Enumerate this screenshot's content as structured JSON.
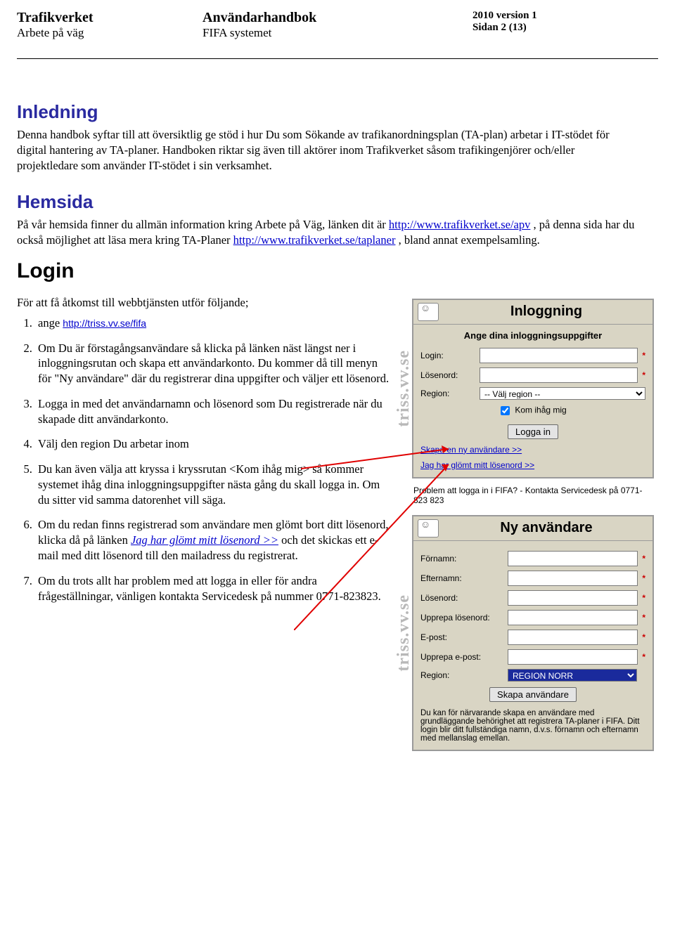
{
  "header": {
    "left_bold": "Trafikverket",
    "left_sub": "Arbete på väg",
    "center_bold": "Användarhandbok",
    "center_sub": "FIFA systemet",
    "version": "2010 version 1",
    "page": "Sidan 2 (13)"
  },
  "sections": {
    "inledning_title": "Inledning",
    "inledning_body": "Denna handbok syftar till att översiktlig ge stöd i hur Du som Sökande av trafikanordningsplan (TA-plan) arbetar i IT-stödet för digital hantering av TA-planer. Handboken riktar sig även till aktörer inom Trafikverket såsom trafikingenjörer och/eller projektledare som använder IT-stödet i sin verksamhet.",
    "hemsida_title": "Hemsida",
    "hemsida_pre": "På vår hemsida finner du allmän information kring Arbete på Väg, länken dit är ",
    "hemsida_link1": "http://www.trafikverket.se/apv",
    "hemsida_mid": " , på denna sida har du också möjlighet att läsa mera kring TA-Planer ",
    "hemsida_link2": "http://www.trafikverket.se/taplaner",
    "hemsida_post": " , bland annat exempelsamling.",
    "login_title": "Login"
  },
  "steps": {
    "intro": "För att få åtkomst till webbtjänsten utför följande;",
    "s1_pre": "ange ",
    "s1_link": "http://triss.vv.se/fifa",
    "s2": "Om Du är förstagångsanvändare så klicka på länken näst längst ner i inloggningsrutan och skapa ett användarkonto. Du kommer då till menyn för \"Ny användare\" där du registrerar dina uppgifter och väljer ett lösenord.",
    "s3": "Logga in med det användarnamn och lösenord som Du registrerade när du skapade ditt användarkonto.",
    "s4": "Välj den region Du arbetar inom",
    "s5": "Du kan även välja att kryssa i kryssrutan <Kom ihåg mig> så kommer systemet ihåg dina inloggningsuppgifter nästa gång du skall logga in. Om du sitter vid samma datorenhet vill säga.",
    "s6_pre": "Om du redan finns registrerad som användare men glömt bort ditt lösenord, klicka då på länken ",
    "s6_link": "Jag har glömt mitt lösenord >>",
    "s6_post": " och det skickas ett e-mail med ditt lösenord till den mailadress du registrerat.",
    "s7": "Om du trots allt har problem med att logga in eller för andra frågeställningar, vänligen kontakta Servicedesk på nummer 0771-823823."
  },
  "login_panel": {
    "title": "Inloggning",
    "subtitle": "Ange dina inloggningsuppgifter",
    "login_label": "Login:",
    "password_label": "Lösenord:",
    "region_label": "Region:",
    "region_placeholder": "-- Välj region --",
    "remember_label": "Kom ihåg mig",
    "button": "Logga in",
    "link_new": "Skapa en ny användare >>",
    "link_forgot": "Jag har glömt mitt lösenord >>",
    "watermark": "triss.vv.se"
  },
  "problem_text": "Problem att logga in i FIFA? - Kontakta Servicedesk på 0771-823 823",
  "newuser_panel": {
    "title": "Ny användare",
    "fornamn": "Förnamn:",
    "efternamn": "Efternamn:",
    "losenord": "Lösenord:",
    "upprepa_losen": "Upprepa lösenord:",
    "epost": "E-post:",
    "upprepa_epost": "Upprepa e-post:",
    "region": "Region:",
    "region_value": "REGION NORR",
    "button": "Skapa användare",
    "note": "Du kan för närvarande skapa en användare med grundläggande behörighet att registrera TA-planer i FIFA. Ditt login blir ditt fullständiga namn, d.v.s. förnamn och efternamn med mellanslag emellan.",
    "watermark": "triss.vv.se"
  }
}
